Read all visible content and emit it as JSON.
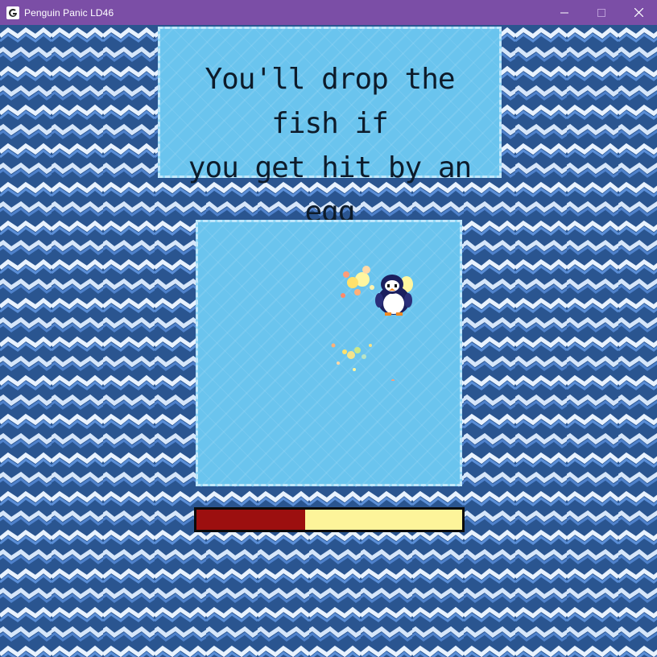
{
  "window": {
    "title": "Penguin Panic LD46",
    "controls": {
      "minimize_icon": "minimize-icon",
      "maximize_icon": "maximize-icon",
      "close_icon": "close-icon"
    },
    "titlebar_color": "#7b4ea6"
  },
  "game": {
    "tutorial_text": "You'll drop the fish if\nyou get hit by an egg",
    "bar": {
      "filled_fraction": 0.41,
      "fill_color": "#9c0f0f",
      "empty_color": "#fdf49a"
    },
    "colors": {
      "water_dark": "#2a5590",
      "water_mid": "#4a7fd0",
      "ice": "#6ac4ee"
    },
    "player_icon": "penguin-icon"
  }
}
